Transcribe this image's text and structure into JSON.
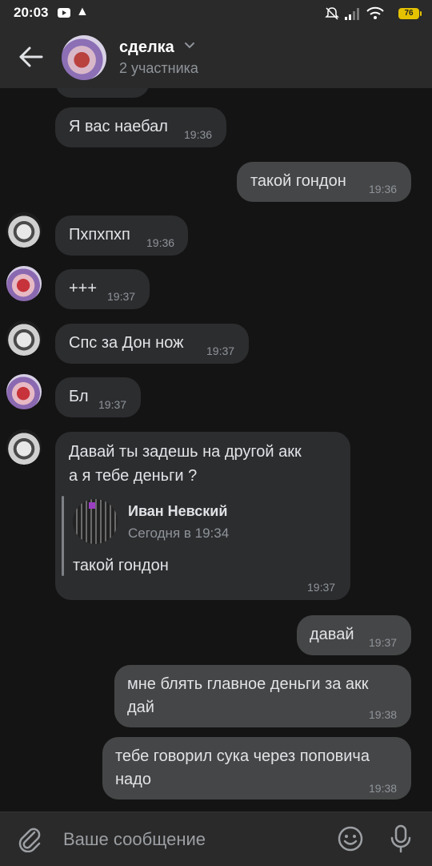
{
  "status_bar": {
    "time": "20:03",
    "battery": "76"
  },
  "header": {
    "title": "сделка",
    "subtitle": "2 участника"
  },
  "messages": [
    {
      "text": "Я вас наебал",
      "time": "19:36"
    },
    {
      "text": "такой гондон",
      "time": "19:36"
    },
    {
      "text": "Пхпхпхп",
      "time": "19:36"
    },
    {
      "text": "+++",
      "time": "19:37"
    },
    {
      "text": "Спс за Дон нож",
      "time": "19:37"
    },
    {
      "text": "Бл",
      "time": "19:37"
    },
    {
      "text_line1": "Давай ты задешь на другой акк",
      "text_line2": "а я тебе деньги ?",
      "reply": {
        "name": "Иван Невский",
        "date": "Сегодня в 19:34",
        "text": "такой гондон"
      },
      "time": "19:37"
    },
    {
      "text": "давай",
      "time": "19:37"
    },
    {
      "text_line1": "мне блять главное деньги за акк",
      "text_line2": "дай",
      "time": "19:38"
    },
    {
      "text_line1": "тебе говорил сука через поповича",
      "text_line2": "надо",
      "time": "19:38"
    }
  ],
  "input": {
    "placeholder": "Ваше сообщение"
  },
  "colors": {
    "background": "#141414",
    "bubble_in": "#2c2d2f",
    "bubble_out": "#454647",
    "bar": "#2a2a2a",
    "accent": "#e5c200"
  }
}
